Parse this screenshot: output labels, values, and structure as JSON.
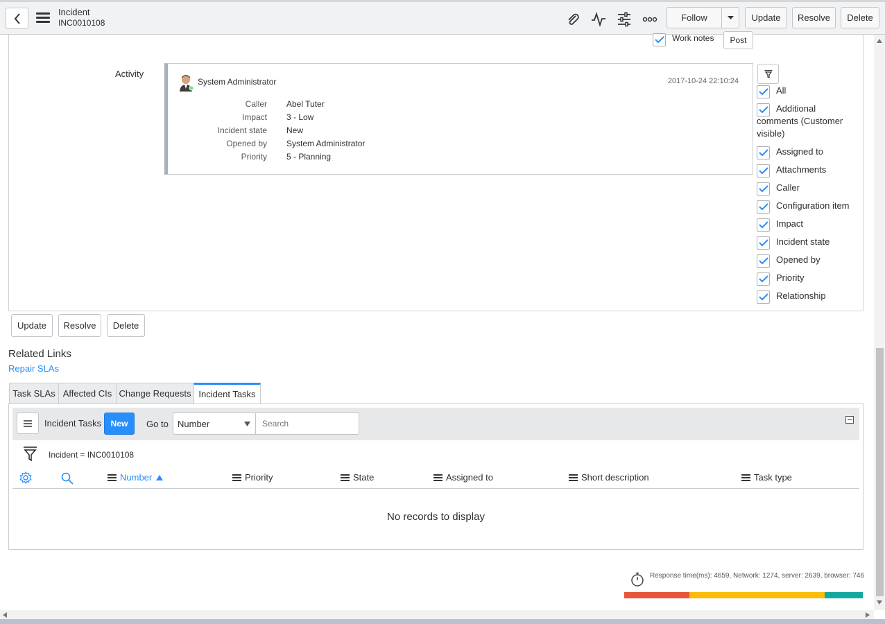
{
  "header": {
    "title": "Incident",
    "number": "INC0010108",
    "follow_label": "Follow",
    "update_label": "Update",
    "resolve_label": "Resolve",
    "delete_label": "Delete"
  },
  "form": {
    "work_notes_label": "Work notes",
    "post_label": "Post",
    "activity_label": "Activity"
  },
  "activity": {
    "author": "System Administrator",
    "timestamp": "2017-10-24 22:10:24",
    "fields": [
      {
        "key": "Caller",
        "value": "Abel Tuter"
      },
      {
        "key": "Impact",
        "value": "3 - Low"
      },
      {
        "key": "Incident state",
        "value": "New"
      },
      {
        "key": "Opened by",
        "value": "System Administrator"
      },
      {
        "key": "Priority",
        "value": "5 - Planning"
      }
    ]
  },
  "activity_filter": {
    "options": [
      "All",
      "Additional comments (Customer visible)",
      "Assigned to",
      "Attachments",
      "Caller",
      "Configuration item",
      "Impact",
      "Incident state",
      "Opened by",
      "Priority",
      "Relationship"
    ]
  },
  "bottom_buttons": {
    "update": "Update",
    "resolve": "Resolve",
    "delete": "Delete"
  },
  "related": {
    "title": "Related Links",
    "repair_link": "Repair SLAs",
    "tabs": [
      "Task SLAs",
      "Affected CIs",
      "Change Requests",
      "Incident Tasks"
    ],
    "active_tab": "Incident Tasks"
  },
  "list": {
    "title": "Incident Tasks",
    "new_label": "New",
    "goto_label": "Go to",
    "goto_field": "Number",
    "search_placeholder": "Search",
    "filter_text": "Incident = INC0010108",
    "columns": [
      "Number",
      "Priority",
      "State",
      "Assigned to",
      "Short description",
      "Task type"
    ],
    "sorted_column": "Number",
    "empty_message": "No records to display"
  },
  "footer": {
    "response_text": "Response time(ms): 4659, Network: 1274, server: 2639, browser: 746",
    "network_ms": 1274,
    "server_ms": 2639,
    "browser_ms": 746,
    "network_color": "#e8553d",
    "server_color": "#fbbd0a",
    "browser_color": "#13a9a2"
  },
  "colors": {
    "accent": "#278efc",
    "status_online": "#71e279"
  }
}
